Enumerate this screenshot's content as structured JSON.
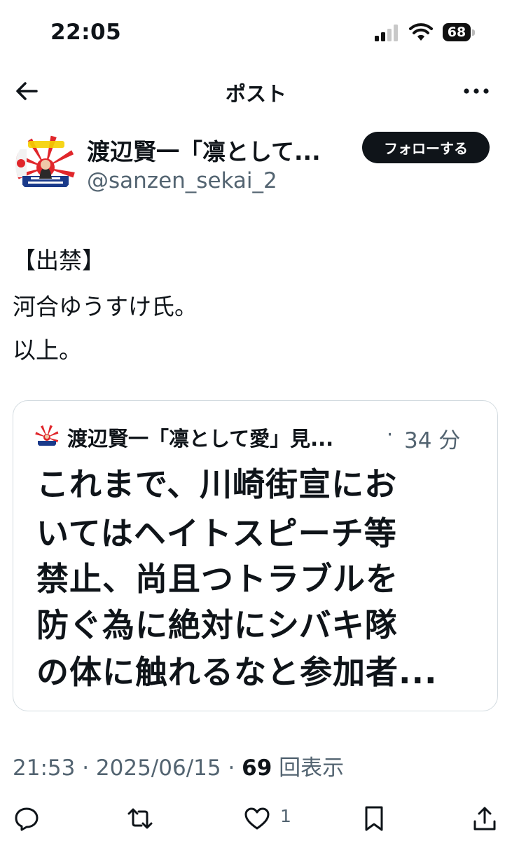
{
  "status_bar": {
    "time": "22:05",
    "battery": "68"
  },
  "header": {
    "title": "ポスト",
    "back_icon": "arrow-left-icon",
    "more_icon": "more-horizontal-icon"
  },
  "author": {
    "name": "渡辺賢一「凛として...",
    "handle": "@sanzen_sekai_2",
    "follow_label": "フォローする"
  },
  "post": {
    "lines": [
      "【出禁】",
      "河合ゆうすけ氏。",
      "以上。"
    ]
  },
  "quote": {
    "author": "渡辺賢一「凛として愛」見...",
    "separator": "·",
    "time": "34 分",
    "lines": [
      "これまで、川崎街宣にお",
      "いてはヘイトスピーチ等",
      "禁止、尚且つトラブルを",
      "防ぐ為に絶対にシバキ隊",
      "の体に触れるなと参加者..."
    ]
  },
  "meta": {
    "time": "21:53",
    "sep": " · ",
    "date": "2025/06/15",
    "views_count": "69",
    "views_label": " 回表示"
  },
  "actions": {
    "reply_icon": "reply-icon",
    "repost_icon": "repost-icon",
    "like_icon": "heart-icon",
    "like_count": "1",
    "bookmark_icon": "bookmark-icon",
    "share_icon": "share-icon"
  },
  "colors": {
    "text": "#0f1419",
    "secondary": "#536471",
    "border": "#d3dbe0",
    "follow_bg": "#0f1419"
  }
}
